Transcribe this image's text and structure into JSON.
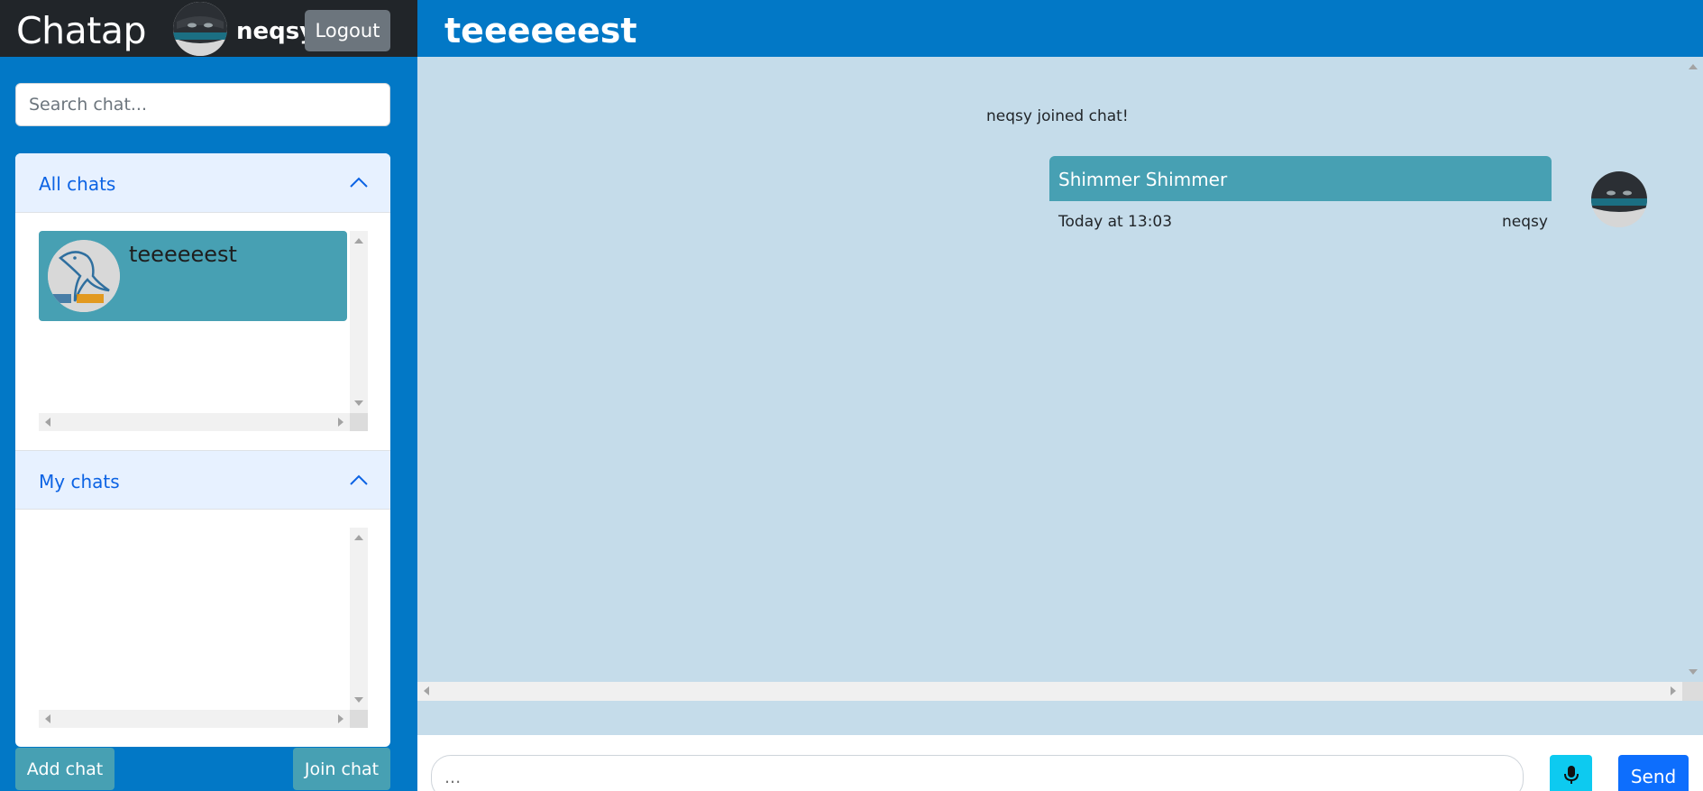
{
  "app": {
    "brand": "Chatap",
    "username": "neqsy",
    "logout_label": "Logout"
  },
  "sidebar": {
    "search_placeholder": "Search chat...",
    "sections": [
      {
        "title": "All chats",
        "items": [
          {
            "name": "teeeeeest"
          }
        ]
      },
      {
        "title": "My chats",
        "items": []
      }
    ],
    "add_chat_label": "Add chat",
    "join_chat_label": "Join chat"
  },
  "chat": {
    "title": "teeeeeest",
    "system_message": "neqsy joined chat!",
    "messages": [
      {
        "text": "Shimmer Shimmer",
        "time": "Today at 13:03",
        "author": "neqsy"
      }
    ],
    "input_placeholder": "...",
    "send_label": "Send"
  },
  "icons": {
    "chevron": "chevron-up-icon",
    "mic": "microphone-icon"
  },
  "colors": {
    "primary": "#0278c6",
    "dark": "#212529",
    "bubble": "#47a0b3",
    "chat_bg": "#c5dcea",
    "send": "#0d6efd",
    "mic": "#0dcaf0"
  }
}
